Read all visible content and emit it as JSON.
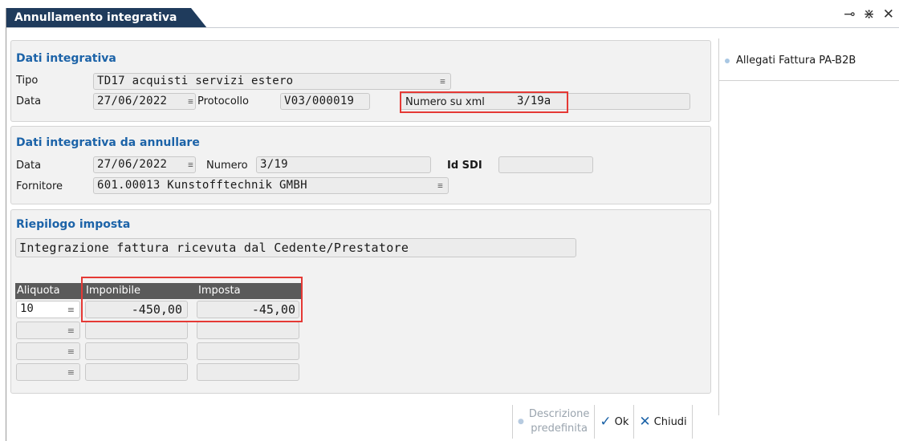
{
  "window": {
    "title": "Annullamento integrativa",
    "controls": [
      "pin-icon",
      "expand-icon",
      "close-icon"
    ]
  },
  "dati_integrativa": {
    "title": "Dati integrativa",
    "tipo_label": "Tipo",
    "tipo_value": "TD17 acquisti servizi estero",
    "data_label": "Data",
    "data_value": "27/06/2022",
    "protocollo_label": "Protocollo",
    "protocollo_value": "V03/000019",
    "numero_xml_label": "Numero su xml",
    "numero_xml_value": "3/19a"
  },
  "dati_annullare": {
    "title": "Dati integrativa da annullare",
    "data_label": "Data",
    "data_value": "27/06/2022",
    "numero_label": "Numero",
    "numero_value": "3/19",
    "idsdi_label": "Id SDI",
    "idsdi_value": "",
    "fornitore_label": "Fornitore",
    "fornitore_value": "601.00013 Kunstofftechnik GMBH"
  },
  "riepilogo": {
    "title": "Riepilogo imposta",
    "descrizione": "Integrazione fattura ricevuta dal Cedente/Prestatore",
    "columns": [
      "Aliquota",
      "Imponibile",
      "Imposta"
    ],
    "rows": [
      {
        "aliquota": "10",
        "imponibile": "-450,00",
        "imposta": "-45,00"
      },
      {
        "aliquota": "",
        "imponibile": "",
        "imposta": ""
      },
      {
        "aliquota": "",
        "imponibile": "",
        "imposta": ""
      },
      {
        "aliquota": "",
        "imponibile": "",
        "imposta": ""
      }
    ]
  },
  "side": {
    "allegati_label": "Allegati Fattura PA-B2B"
  },
  "buttons": {
    "descrizione_line1": "Descrizione",
    "descrizione_line2": "predefinita",
    "ok_label": "Ok",
    "chiudi_label": "Chiudi"
  },
  "colors": {
    "title_bg": "#1f3b5c",
    "section_title": "#1c63a8",
    "highlight": "#e53935",
    "table_header": "#5a5a5a"
  }
}
